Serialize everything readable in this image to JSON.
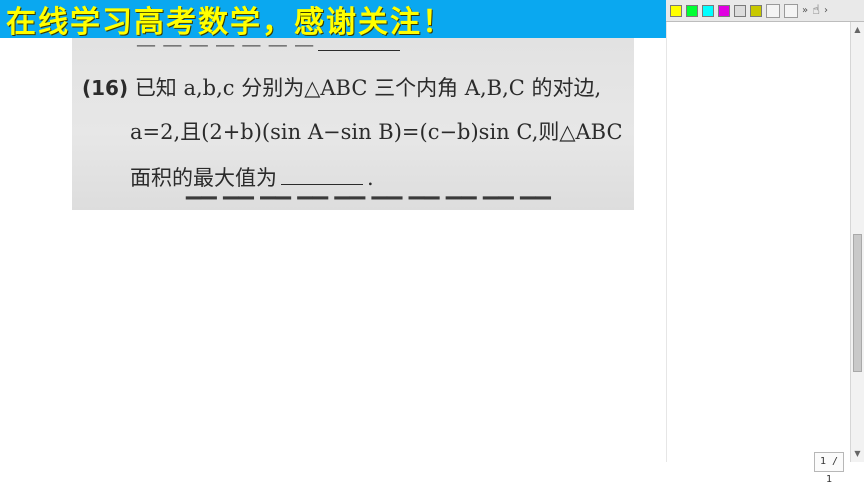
{
  "banner": {
    "text": "在线学习高考数学，感谢关注！"
  },
  "toolbar": {
    "colors": [
      "#ffff00",
      "#00ff33",
      "#00ffff",
      "#e100e1",
      "#c8c8c8",
      "#d8d8d8",
      "#c8c800"
    ],
    "hand_icon": "hand-icon",
    "chevron": "»"
  },
  "scan": {
    "question_number": "(16)",
    "line1": "已知 a,b,c 分别为△ABC 三个内角 A,B,C 的对边,",
    "line2": "a=2,且(2+b)(sin A−sin B)=(c−b)sin C,则△ABC",
    "line3_prefix": "面积的最大值为",
    "line3_suffix": "."
  },
  "page_indicator": {
    "text": "1 / 1"
  }
}
